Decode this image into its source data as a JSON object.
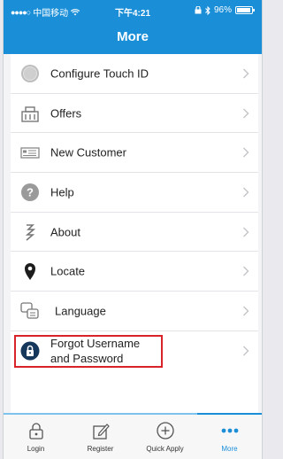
{
  "status_bar": {
    "carrier": "中国移动",
    "time": "下午4:21",
    "battery": "96%"
  },
  "header": {
    "title": "More"
  },
  "menu": {
    "items": [
      {
        "label": "Configure Touch ID",
        "icon": "touch-id-icon"
      },
      {
        "label": "Offers",
        "icon": "offers-icon"
      },
      {
        "label": "New Customer",
        "icon": "new-customer-card-icon"
      },
      {
        "label": "Help",
        "icon": "help-icon"
      },
      {
        "label": "About",
        "icon": "about-logo-icon"
      },
      {
        "label": "Locate",
        "icon": "location-pin-icon"
      },
      {
        "label": "Language",
        "icon": "language-icon"
      },
      {
        "label_line1": "Forgot Username",
        "label_line2": "and Password",
        "icon": "lock-icon",
        "highlighted": true
      }
    ]
  },
  "tabbar": {
    "tabs": [
      {
        "label": "Login",
        "icon": "lock-outline-icon"
      },
      {
        "label": "Register",
        "icon": "register-pen-icon"
      },
      {
        "label": "Quick Apply",
        "icon": "plus-circle-icon"
      },
      {
        "label": "More",
        "icon": "more-dots-icon",
        "active": true
      }
    ]
  },
  "colors": {
    "brand_blue": "#1a8fd8",
    "highlight_red": "#d8232a"
  }
}
